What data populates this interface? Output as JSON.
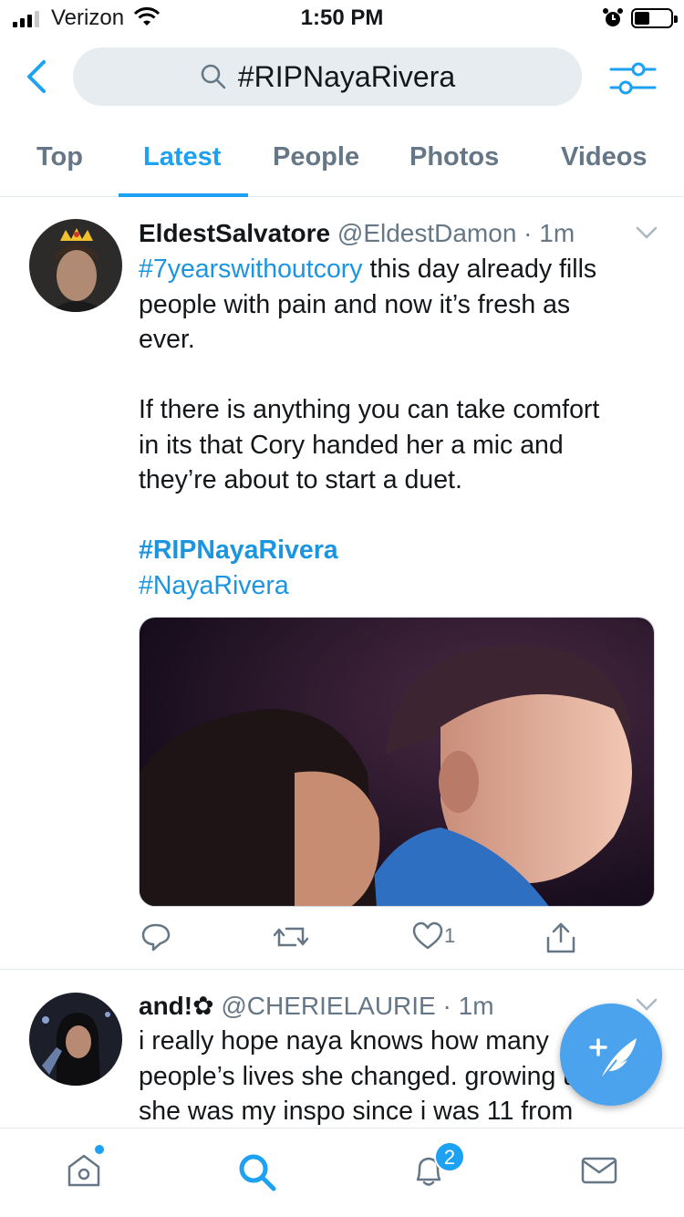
{
  "status_bar": {
    "carrier": "Verizon",
    "time": "1:50 PM"
  },
  "header": {
    "search_query": "#RIPNayaRivera"
  },
  "tabs": [
    {
      "label": "Top"
    },
    {
      "label": "Latest"
    },
    {
      "label": "People"
    },
    {
      "label": "Photos"
    },
    {
      "label": "Videos"
    }
  ],
  "active_tab": "Latest",
  "tweets": [
    {
      "name": "EldestSalvatore",
      "handle": "@EldestDamon",
      "sep": " · ",
      "time": "1m",
      "hashtag_lead": "#7yearswithoutcory",
      "line_1_rest": " this day already fills",
      "line_2": "people with pain and now it’s fresh as",
      "line_3": "ever.",
      "line_4": "If there is anything you can take comfort",
      "line_5": "in its that Cory handed her a mic and",
      "line_6": "they’re about to start a duet.",
      "hashtag_1": "#RIPNayaRivera",
      "hashtag_2": "#NayaRivera",
      "likes": "1"
    },
    {
      "name": "and!",
      "name_glyph": "✿",
      "handle": "@CHERIELAURIE",
      "sep": " · ",
      "time": "1m",
      "line_1": "i really hope naya knows how many",
      "line_2": "people’s lives she changed. growing up",
      "line_3": "she was my inspo since i was 11 from"
    }
  ],
  "bottom_nav": {
    "notifications_badge": "2"
  },
  "colors": {
    "accent": "#1da1f2",
    "link": "#1b95e0",
    "muted": "#657786",
    "fab": "#4aa3ec"
  }
}
